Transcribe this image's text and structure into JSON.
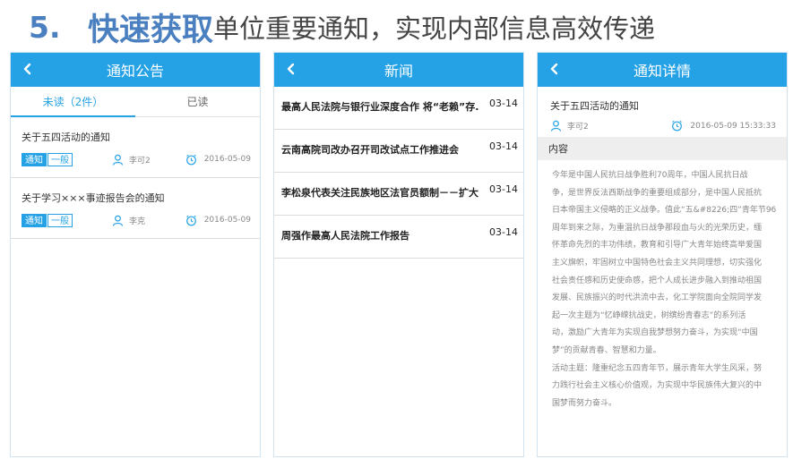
{
  "slide": {
    "number": "5.",
    "title_strong": "快速获取",
    "title_rest": "单位重要通知，实现内部信息高效传递"
  },
  "colors": {
    "accent": "#25a2e6",
    "title_blue": "#4a7fc0"
  },
  "notice_screen": {
    "header": "通知公告",
    "back_icon": "chevron-left-icon",
    "tabs": [
      {
        "label": "未读（2件）",
        "active": true
      },
      {
        "label": "已读",
        "active": false
      }
    ],
    "items": [
      {
        "title": "关于五四活动的通知",
        "tag1": "通知",
        "tag2": "一般",
        "person": "李可2",
        "date": "2016-05-09"
      },
      {
        "title": "关于学习×××事迹报告会的通知",
        "tag1": "通知",
        "tag2": "一般",
        "person": "李克",
        "date": "2016-05-09"
      }
    ]
  },
  "news_screen": {
    "header": "新闻",
    "items": [
      {
        "title": "最高人民法院与银行业深度合作 将“老赖”存...",
        "date": "03-14"
      },
      {
        "title": "云南高院司改办召开司改试点工作推进会",
        "date": "03-14"
      },
      {
        "title": "李松泉代表关注民族地区法官员额制－－扩大...",
        "date": "03-14"
      },
      {
        "title": "周强作最高人民法院工作报告",
        "date": "03-14"
      }
    ]
  },
  "detail_screen": {
    "header": "通知详情",
    "title": "关于五四活动的通知",
    "person": "李可2",
    "datetime": "2016-05-09 15:33:33",
    "section_label": "内容",
    "lines": [
      "今年是中国人民抗日战争胜利70周年，中国人民抗日战",
      "争，是世界反法西斯战争的重要组成部分，是中国人民抵抗",
      "日本帝国主义侵略的正义战争。值此“五&#8226;四”青年节96",
      "周年到来之际，为重温抗日战争那段血与火的光荣历史，缅",
      "怀革命先烈的丰功伟绩，教育和引导广大青年始终高举爱国",
      "主义旗帜，牢固树立中国特色社会主义共同理想，切实强化",
      "社会责任感和历史使命感，把个人成长进步融入到推动祖国",
      "发展、民族振兴的时代洪流中去，化工学院面向全院同学发",
      "起一次主题为“忆峥嵘抗战史，树缤纷青春志”的系列活",
      "动，激励广大青年为实现自我梦想努力奋斗，为实现“中国",
      "梦”的贡献青春、智慧和力量。",
      "活动主题：隆重纪念五四青年节，展示青年大学生风采，努",
      "力践行社会主义核心价值观，为实现中华民族伟大复兴的中",
      "国梦而努力奋斗。"
    ]
  }
}
